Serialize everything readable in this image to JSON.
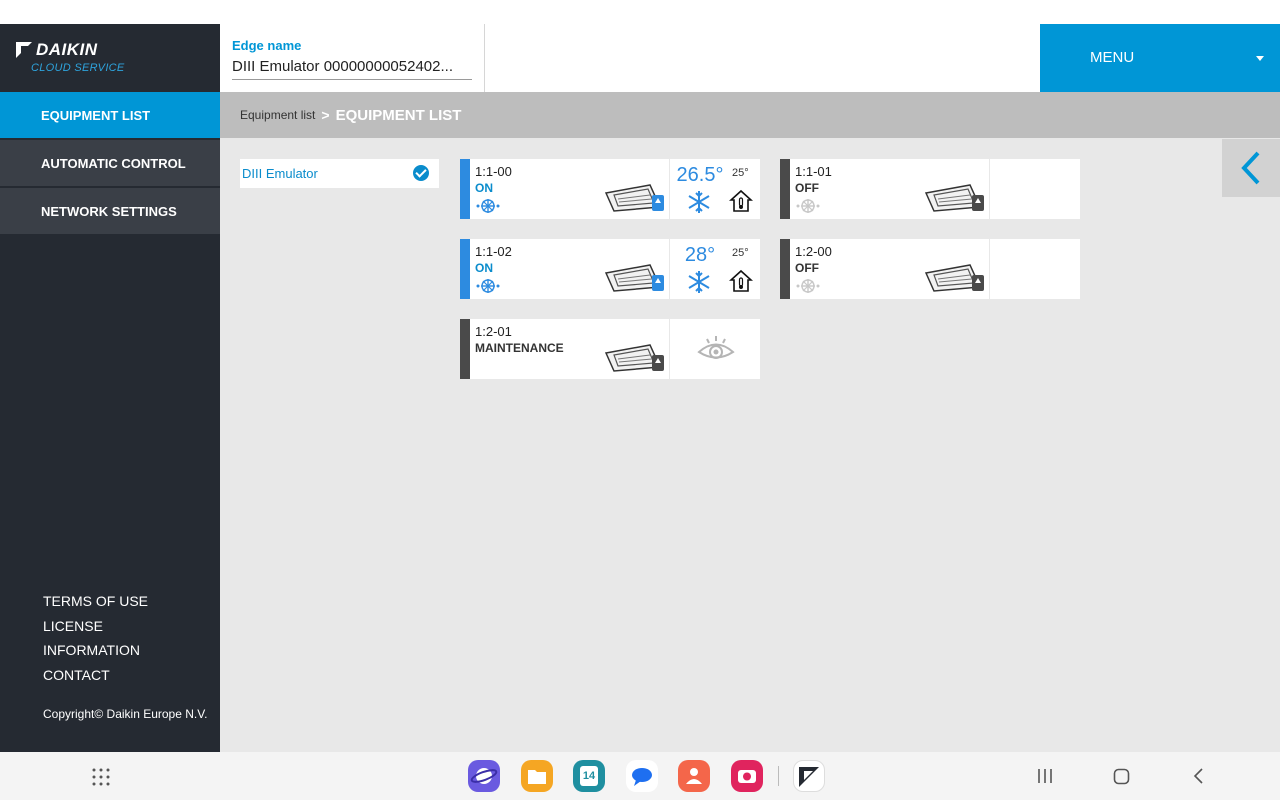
{
  "brand": {
    "name": "DAIKIN",
    "subtitle": "CLOUD SERVICE"
  },
  "header": {
    "edge_label": "Edge name",
    "edge_value": "DIII Emulator 00000000052402...",
    "menu_label": "MENU"
  },
  "sidebar": {
    "items": [
      {
        "label": "EQUIPMENT LIST",
        "active": true
      },
      {
        "label": "AUTOMATIC CONTROL",
        "active": false
      },
      {
        "label": "NETWORK SETTINGS",
        "active": false
      }
    ],
    "footer_links": [
      "TERMS OF USE",
      "LICENSE",
      "INFORMATION",
      "CONTACT"
    ],
    "copyright": "Copyright© Daikin Europe N.V."
  },
  "breadcrumb": {
    "parent": "Equipment list",
    "separator": ">",
    "current": "EQUIPMENT LIST"
  },
  "edge_list": {
    "name": "DIII Emulator",
    "selected": true
  },
  "units": [
    {
      "id": "1:1-00",
      "status": "ON",
      "setpoint": "26.5°",
      "room_temp": "25°",
      "mode": "cooling"
    },
    {
      "id": "1:1-01",
      "status": "OFF",
      "setpoint": "",
      "room_temp": "",
      "mode": "cooling"
    },
    {
      "id": "1:1-02",
      "status": "ON",
      "setpoint": "28°",
      "room_temp": "25°",
      "mode": "cooling"
    },
    {
      "id": "1:2-00",
      "status": "OFF",
      "setpoint": "",
      "room_temp": "",
      "mode": "cooling"
    },
    {
      "id": "1:2-01",
      "status": "MAINTENANCE",
      "setpoint": "",
      "room_temp": "",
      "mode": "maintenance"
    }
  ],
  "taskbar": {
    "apps": [
      "internet-browser-icon",
      "my-files-icon",
      "calendar-icon",
      "messages-icon",
      "contacts-icon",
      "camera-icon",
      "daikin-app-icon"
    ],
    "calendar_day": "14"
  },
  "colors": {
    "accent": "#0096d6",
    "sidebar": "#252a32",
    "on": "#2d8be0",
    "off": "#4a4a4a"
  }
}
